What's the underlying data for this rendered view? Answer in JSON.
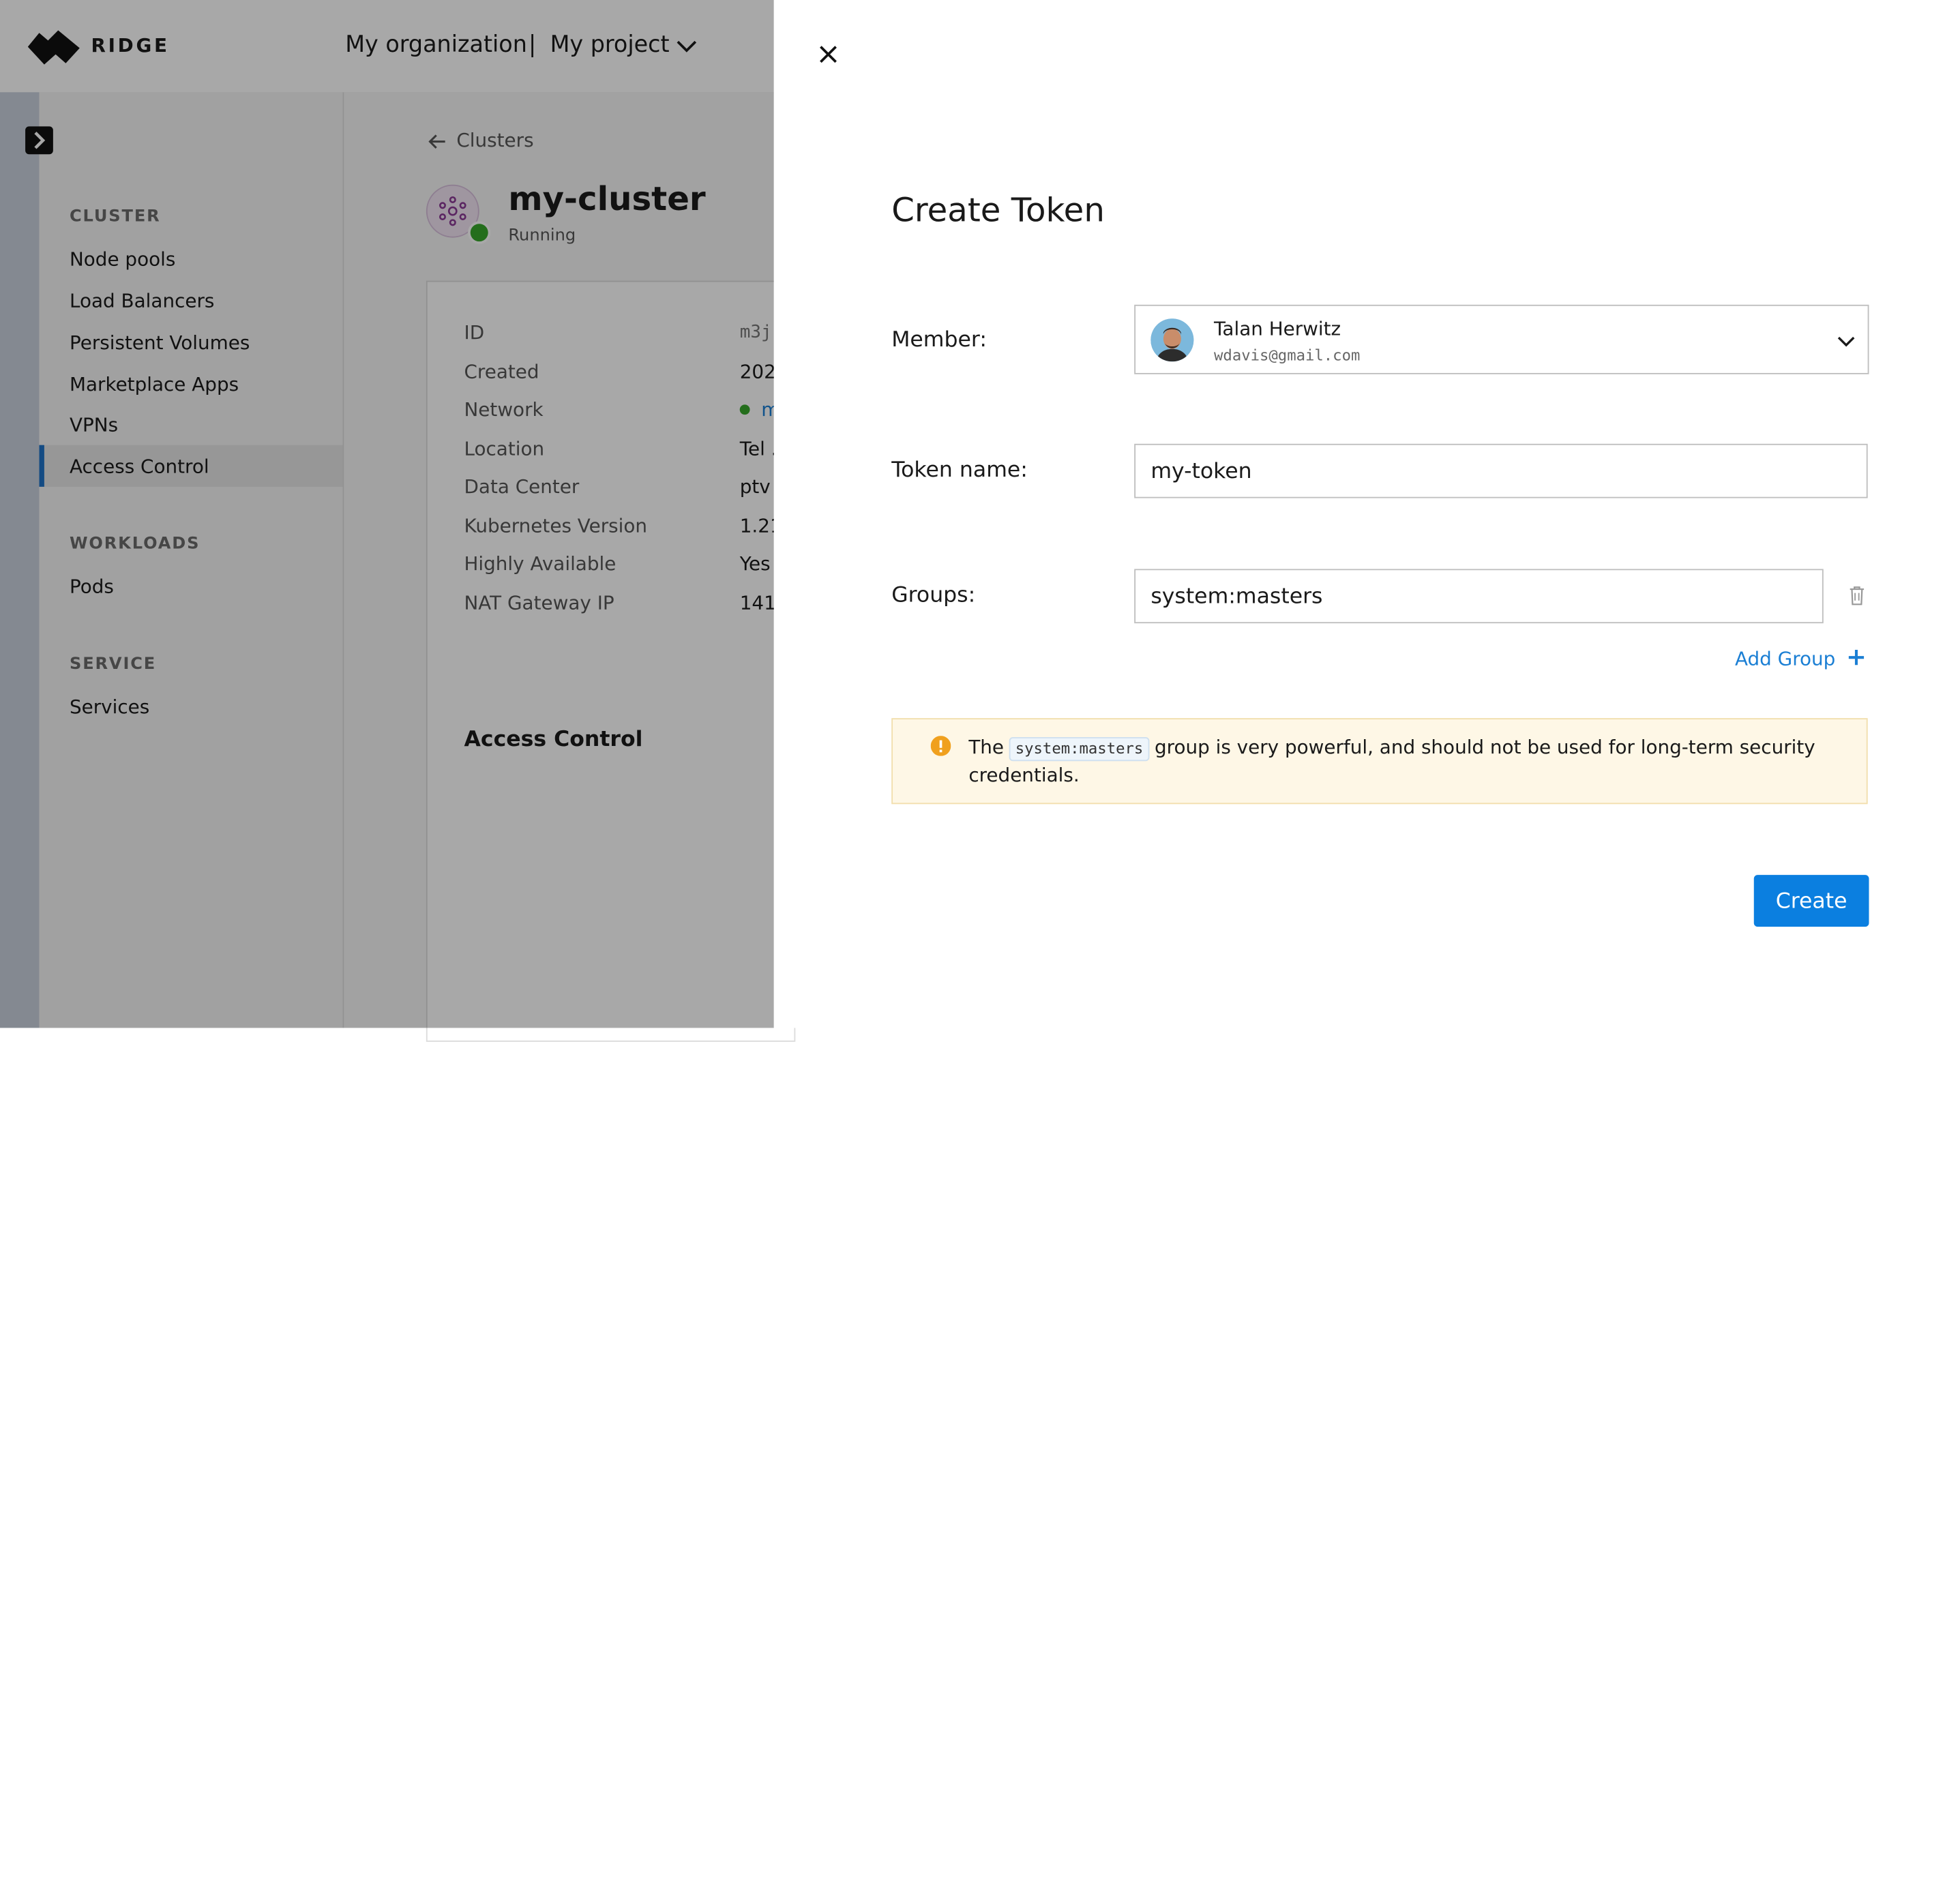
{
  "topbar": {
    "brand": "RIDGE",
    "organization": "My organization",
    "separator": "|",
    "project": "My project"
  },
  "sidebar": {
    "sections": [
      {
        "heading": "CLUSTER",
        "items": [
          "Node pools",
          "Load Balancers",
          "Persistent Volumes",
          "Marketplace Apps",
          "VPNs",
          "Access Control"
        ]
      },
      {
        "heading": "WORKLOADS",
        "items": [
          "Pods"
        ]
      },
      {
        "heading": "SERVICE",
        "items": [
          "Services"
        ]
      }
    ],
    "active_item": "Access Control"
  },
  "main": {
    "breadcrumb": "Clusters",
    "cluster_name": "my-cluster",
    "cluster_status": "Running",
    "details": [
      {
        "label": "ID",
        "value": "m3j"
      },
      {
        "label": "Created",
        "value": "202"
      },
      {
        "label": "Network",
        "value": "m"
      },
      {
        "label": "Location",
        "value": "Tel ."
      },
      {
        "label": "Data Center",
        "value": "ptv"
      },
      {
        "label": "Kubernetes Version",
        "value": "1.21"
      },
      {
        "label": "Highly Available",
        "value": "Yes"
      },
      {
        "label": "NAT Gateway IP",
        "value": "141"
      }
    ],
    "section_title": "Access Control"
  },
  "drawer": {
    "title": "Create Token",
    "member_label": "Member:",
    "member": {
      "name": "Talan Herwitz",
      "email": "wdavis@gmail.com"
    },
    "token_label": "Token name:",
    "token_value": "my-token",
    "groups_label": "Groups:",
    "groups_value": "system:masters",
    "add_group_label": "Add Group",
    "warning": {
      "prefix": "The",
      "code": "system:masters",
      "suffix": "group is very powerful, and should not be used for long-term security credentials."
    },
    "create_label": "Create"
  },
  "colors": {
    "accent": "#0b7fe0",
    "active_nav_bar": "#1f73c7",
    "status_running": "#38a82b",
    "warning_bg": "#fef7e6",
    "warning_icon": "#f0a01e"
  }
}
